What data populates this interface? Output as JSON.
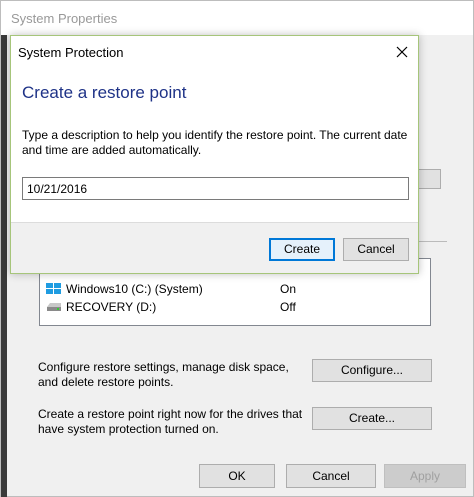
{
  "system_properties": {
    "title": "System Properties",
    "drives": [
      {
        "name": "Windows10 (C:) (System)",
        "status": "On",
        "icon": "windows-drive-icon"
      },
      {
        "name": "RECOVERY (D:)",
        "status": "Off",
        "icon": "drive-icon"
      }
    ],
    "configure_text": "Configure restore settings, manage disk space, and delete restore points.",
    "configure_button": "Configure...",
    "create_text": "Create a restore point right now for the drives that have system protection turned on.",
    "create_button": "Create...",
    "ok_button": "OK",
    "cancel_button": "Cancel",
    "apply_button": "Apply"
  },
  "dialog": {
    "title": "System Protection",
    "heading": "Create a restore point",
    "description": "Type a description to help you identify the restore point. The current date and time are added automatically.",
    "input_value": "10/21/2016",
    "create_button": "Create",
    "cancel_button": "Cancel",
    "close_icon": "close-icon"
  },
  "colors": {
    "heading": "#1e3287",
    "dialog_border": "#a6c57a",
    "default_button_border": "#0078d7",
    "window_bg": "#f0f0f0"
  }
}
